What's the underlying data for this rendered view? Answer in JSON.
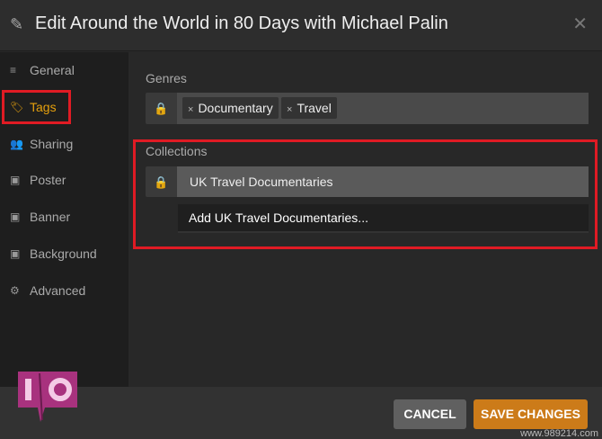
{
  "header": {
    "title": "Edit Around the World in 80 Days with Michael Palin",
    "icon": "pencil-icon",
    "close_icon": "close-icon"
  },
  "sidebar": {
    "items": [
      {
        "label": "General",
        "icon": "≡"
      },
      {
        "label": "Tags",
        "icon": "🏷",
        "active": true
      },
      {
        "label": "Sharing",
        "icon": "👥"
      },
      {
        "label": "Poster",
        "icon": "▣"
      },
      {
        "label": "Banner",
        "icon": "▣"
      },
      {
        "label": "Background",
        "icon": "▣"
      },
      {
        "label": "Advanced",
        "icon": "⚙"
      }
    ]
  },
  "genres": {
    "label": "Genres",
    "tags": [
      "Documentary",
      "Travel"
    ],
    "remove": "×"
  },
  "collections": {
    "label": "Collections",
    "value": "UK Travel Documentaries",
    "suggestion": "Add UK Travel Documentaries..."
  },
  "footer": {
    "cancel": "CANCEL",
    "save": "SAVE CHANGES"
  },
  "colors": {
    "accent": "#e5a00d",
    "save": "#cc7b19",
    "highlight": "#e01b24"
  },
  "logo": {
    "text": "IO"
  },
  "watermark": "www.989214.com"
}
